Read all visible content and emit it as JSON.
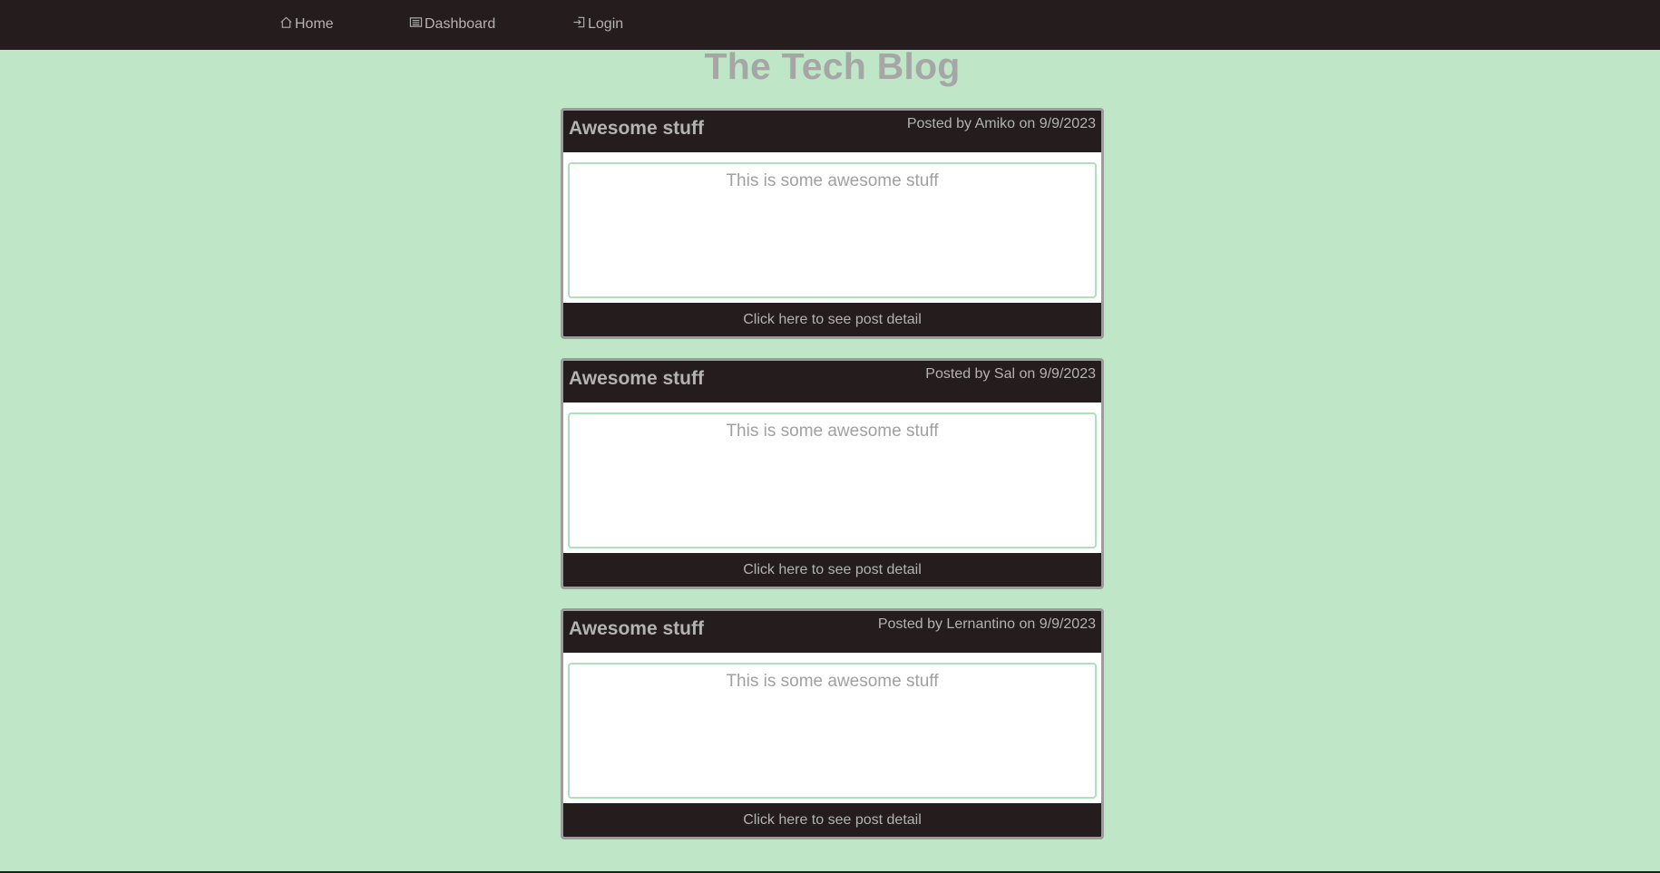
{
  "nav": {
    "home_label": "Home",
    "dashboard_label": "Dashboard",
    "login_label": "Login"
  },
  "page_title": "The Tech Blog",
  "posts": [
    {
      "title": "Awesome stuff",
      "meta": "Posted by Amiko on 9/9/2023",
      "content": "This is some awesome stuff",
      "link_label": "Click here to see post detail"
    },
    {
      "title": "Awesome stuff",
      "meta": "Posted by Sal on 9/9/2023",
      "content": "This is some awesome stuff",
      "link_label": "Click here to see post detail"
    },
    {
      "title": "Awesome stuff",
      "meta": "Posted by Lernantino on 9/9/2023",
      "content": "This is some awesome stuff",
      "link_label": "Click here to see post detail"
    }
  ],
  "colors": {
    "background": "#bfe6c7",
    "navbar": "#241c1d",
    "text_muted": "#b3b3b3",
    "title": "#a6a6a6",
    "card_border": "#9c9c9c",
    "body_border": "#aee0b9"
  },
  "icons": {
    "home": "home-icon",
    "dashboard": "dashboard-icon",
    "login": "login-icon"
  }
}
